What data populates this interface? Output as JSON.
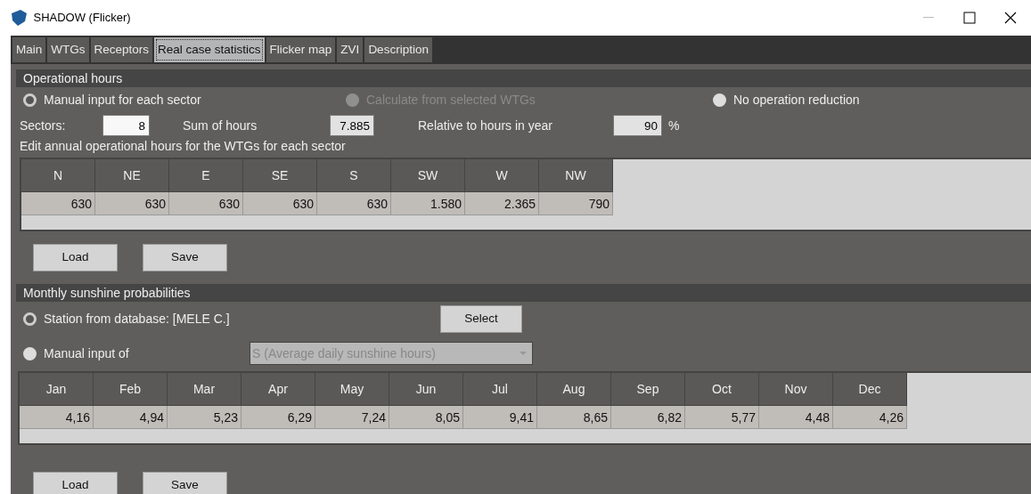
{
  "window": {
    "title": "SHADOW (Flicker)"
  },
  "tabs": [
    {
      "label": "Main",
      "selected": false
    },
    {
      "label": "WTGs",
      "selected": false
    },
    {
      "label": "Receptors",
      "selected": false
    },
    {
      "label": "Real case statistics",
      "selected": true
    },
    {
      "label": "Flicker map",
      "selected": false
    },
    {
      "label": "ZVI",
      "selected": false
    },
    {
      "label": "Description",
      "selected": false
    }
  ],
  "operational_hours": {
    "title": "Operational hours",
    "options": [
      {
        "label": "Manual input for each sector",
        "selected": true,
        "disabled": false
      },
      {
        "label": "Calculate from selected WTGs",
        "selected": false,
        "disabled": true
      },
      {
        "label": "No operation reduction",
        "selected": false,
        "disabled": false
      }
    ],
    "sectors_label": "Sectors:",
    "sectors_value": "8",
    "sum_label": "Sum of hours",
    "sum_value": "7.885",
    "relative_label": "Relative to hours in year",
    "relative_value": "90",
    "relative_unit": "%",
    "hint": "Edit annual operational hours for the WTGs for each sector",
    "table": {
      "columns": [
        "N",
        "NE",
        "E",
        "SE",
        "S",
        "SW",
        "W",
        "NW"
      ],
      "rows": [
        [
          "630",
          "630",
          "630",
          "630",
          "630",
          "1.580",
          "2.365",
          "790"
        ]
      ]
    },
    "buttons": [
      "Load",
      "Save"
    ]
  },
  "sunshine": {
    "title": "Monthly sunshine probabilities",
    "station": {
      "label": "Station from database: [MELE C.]",
      "selected": true,
      "button": "Select"
    },
    "manual": {
      "label": "Manual input of",
      "selected": false,
      "combo_value": "S (Average daily sunshine hours)",
      "disabled": true
    },
    "table": {
      "columns": [
        "Jan",
        "Feb",
        "Mar",
        "Apr",
        "May",
        "Jun",
        "Jul",
        "Aug",
        "Sep",
        "Oct",
        "Nov",
        "Dec"
      ],
      "rows": [
        [
          "4,16",
          "4,94",
          "5,23",
          "6,29",
          "7,24",
          "8,05",
          "9,41",
          "8,65",
          "6,82",
          "5,77",
          "4,48",
          "4,26"
        ]
      ]
    },
    "buttons": [
      "Load",
      "Save"
    ]
  }
}
